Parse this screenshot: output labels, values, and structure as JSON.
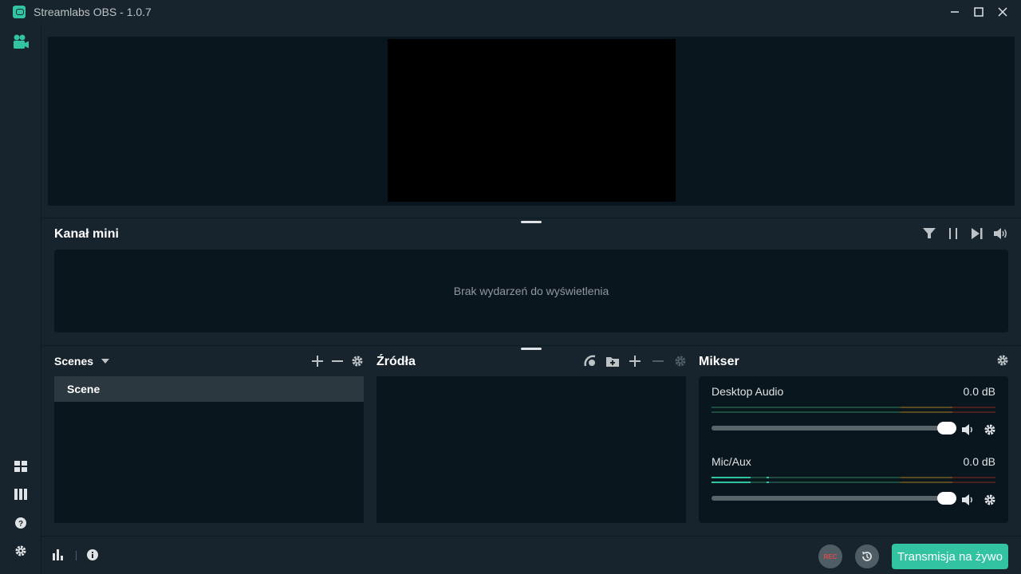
{
  "app": {
    "title": "Streamlabs OBS - 1.0.7",
    "accent": "#31c3a2"
  },
  "sidebar": {
    "top_icon": "studio-camera-icon",
    "bottom_icons": [
      "layout-icon",
      "columns-icon",
      "help-icon",
      "settings-icon"
    ]
  },
  "mini_feed": {
    "title": "Kanał mini",
    "empty_text": "Brak wydarzeń do wyświetlenia",
    "tools": [
      "filter-icon",
      "pause-icon",
      "skip-icon",
      "volume-icon"
    ]
  },
  "scenes": {
    "title": "Scenes",
    "items": [
      {
        "label": "Scene",
        "selected": true
      }
    ]
  },
  "sources": {
    "title": "Źródła",
    "items": []
  },
  "mixer": {
    "title": "Mikser",
    "channels": [
      {
        "name": "Desktop Audio",
        "db": "0.0 dB",
        "level": 0.0,
        "volume": 1.0
      },
      {
        "name": "Mic/Aux",
        "db": "0.0 dB",
        "level": 0.14,
        "volume": 1.0
      }
    ]
  },
  "footer": {
    "rec_label": "REC",
    "go_live_label": "Transmisja na żywo"
  }
}
